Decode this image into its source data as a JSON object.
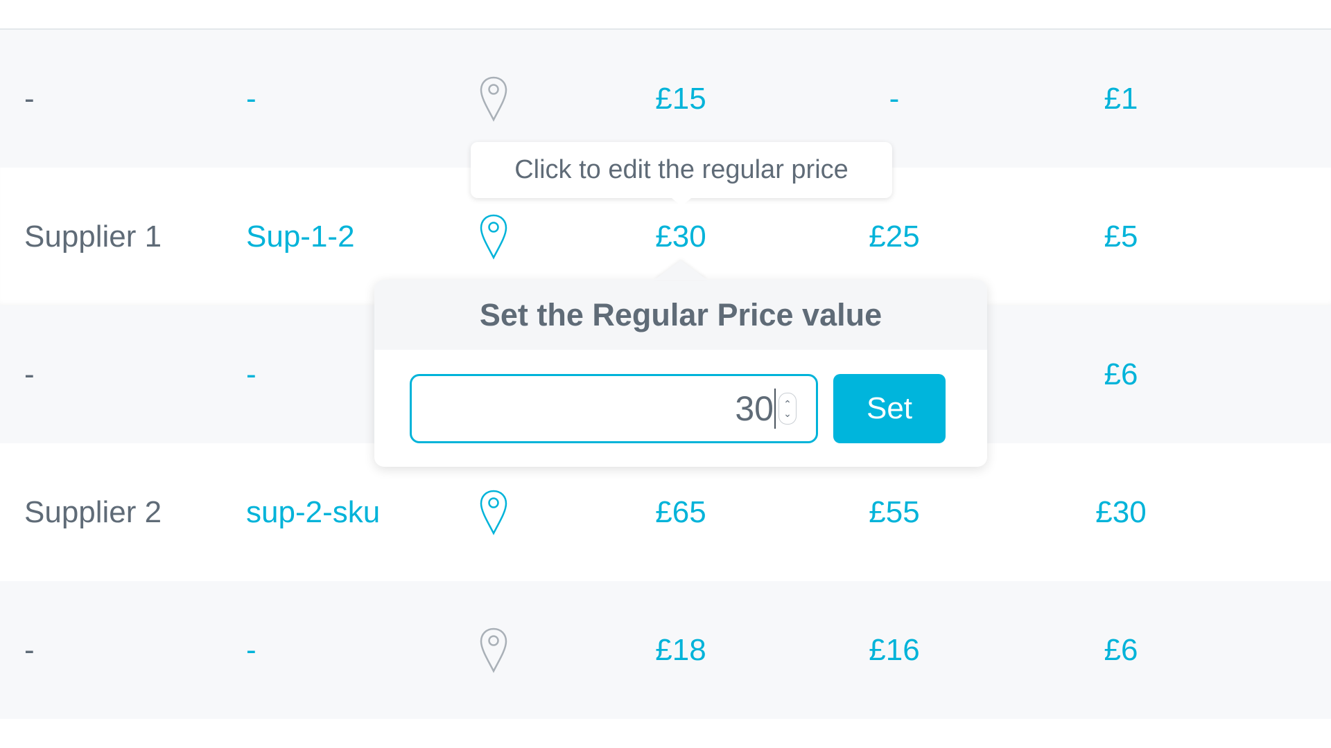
{
  "colors": {
    "accent": "#00b3d9",
    "text_muted": "#5f6b77",
    "pin_inactive": "#a9b0b7",
    "row_alt_bg": "#f7f8fa"
  },
  "rows": [
    {
      "supplier": "-",
      "sku": "-",
      "location_icon": "map-pin-icon",
      "location_active": false,
      "regular_price": "£15",
      "sale_price": "-",
      "cost": "£1"
    },
    {
      "supplier": "Supplier 1",
      "sku": "Sup-1-2",
      "location_icon": "map-pin-icon",
      "location_active": true,
      "regular_price": "£30",
      "sale_price": "£25",
      "cost": "£5"
    },
    {
      "supplier": "-",
      "sku": "-",
      "location_icon": "map-pin-icon",
      "location_active": false,
      "regular_price": "",
      "sale_price": "",
      "cost": "£6"
    },
    {
      "supplier": "Supplier 2",
      "sku": "sup-2-sku",
      "location_icon": "map-pin-icon",
      "location_active": true,
      "regular_price": "£65",
      "sale_price": "£55",
      "cost": "£30"
    },
    {
      "supplier": "-",
      "sku": "-",
      "location_icon": "map-pin-icon",
      "location_active": false,
      "regular_price": "£18",
      "sale_price": "£16",
      "cost": "£6"
    }
  ],
  "tooltip": {
    "text": "Click to edit the regular price"
  },
  "popover": {
    "title": "Set the Regular Price value",
    "input_value": "30",
    "spinner_up": "⌃",
    "spinner_down": "⌄",
    "set_label": "Set"
  }
}
